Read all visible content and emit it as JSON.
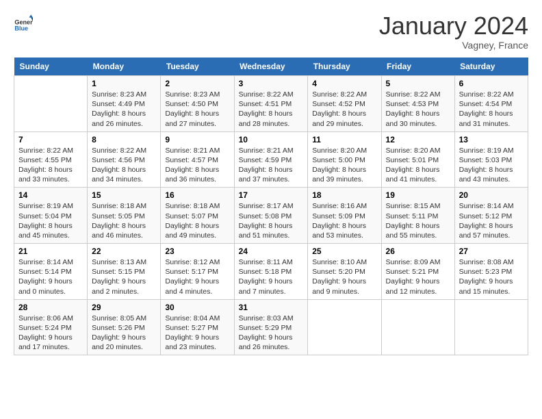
{
  "header": {
    "logo_general": "General",
    "logo_blue": "Blue",
    "month_title": "January 2024",
    "location": "Vagney, France"
  },
  "days_of_week": [
    "Sunday",
    "Monday",
    "Tuesday",
    "Wednesday",
    "Thursday",
    "Friday",
    "Saturday"
  ],
  "weeks": [
    [
      {
        "day": "",
        "sunrise": "",
        "sunset": "",
        "daylight": ""
      },
      {
        "day": "1",
        "sunrise": "8:23 AM",
        "sunset": "4:49 PM",
        "daylight": "8 hours and 26 minutes."
      },
      {
        "day": "2",
        "sunrise": "8:23 AM",
        "sunset": "4:50 PM",
        "daylight": "8 hours and 27 minutes."
      },
      {
        "day": "3",
        "sunrise": "8:22 AM",
        "sunset": "4:51 PM",
        "daylight": "8 hours and 28 minutes."
      },
      {
        "day": "4",
        "sunrise": "8:22 AM",
        "sunset": "4:52 PM",
        "daylight": "8 hours and 29 minutes."
      },
      {
        "day": "5",
        "sunrise": "8:22 AM",
        "sunset": "4:53 PM",
        "daylight": "8 hours and 30 minutes."
      },
      {
        "day": "6",
        "sunrise": "8:22 AM",
        "sunset": "4:54 PM",
        "daylight": "8 hours and 31 minutes."
      }
    ],
    [
      {
        "day": "7",
        "sunrise": "8:22 AM",
        "sunset": "4:55 PM",
        "daylight": "8 hours and 33 minutes."
      },
      {
        "day": "8",
        "sunrise": "8:22 AM",
        "sunset": "4:56 PM",
        "daylight": "8 hours and 34 minutes."
      },
      {
        "day": "9",
        "sunrise": "8:21 AM",
        "sunset": "4:57 PM",
        "daylight": "8 hours and 36 minutes."
      },
      {
        "day": "10",
        "sunrise": "8:21 AM",
        "sunset": "4:59 PM",
        "daylight": "8 hours and 37 minutes."
      },
      {
        "day": "11",
        "sunrise": "8:20 AM",
        "sunset": "5:00 PM",
        "daylight": "8 hours and 39 minutes."
      },
      {
        "day": "12",
        "sunrise": "8:20 AM",
        "sunset": "5:01 PM",
        "daylight": "8 hours and 41 minutes."
      },
      {
        "day": "13",
        "sunrise": "8:19 AM",
        "sunset": "5:03 PM",
        "daylight": "8 hours and 43 minutes."
      }
    ],
    [
      {
        "day": "14",
        "sunrise": "8:19 AM",
        "sunset": "5:04 PM",
        "daylight": "8 hours and 45 minutes."
      },
      {
        "day": "15",
        "sunrise": "8:18 AM",
        "sunset": "5:05 PM",
        "daylight": "8 hours and 46 minutes."
      },
      {
        "day": "16",
        "sunrise": "8:18 AM",
        "sunset": "5:07 PM",
        "daylight": "8 hours and 49 minutes."
      },
      {
        "day": "17",
        "sunrise": "8:17 AM",
        "sunset": "5:08 PM",
        "daylight": "8 hours and 51 minutes."
      },
      {
        "day": "18",
        "sunrise": "8:16 AM",
        "sunset": "5:09 PM",
        "daylight": "8 hours and 53 minutes."
      },
      {
        "day": "19",
        "sunrise": "8:15 AM",
        "sunset": "5:11 PM",
        "daylight": "8 hours and 55 minutes."
      },
      {
        "day": "20",
        "sunrise": "8:14 AM",
        "sunset": "5:12 PM",
        "daylight": "8 hours and 57 minutes."
      }
    ],
    [
      {
        "day": "21",
        "sunrise": "8:14 AM",
        "sunset": "5:14 PM",
        "daylight": "9 hours and 0 minutes."
      },
      {
        "day": "22",
        "sunrise": "8:13 AM",
        "sunset": "5:15 PM",
        "daylight": "9 hours and 2 minutes."
      },
      {
        "day": "23",
        "sunrise": "8:12 AM",
        "sunset": "5:17 PM",
        "daylight": "9 hours and 4 minutes."
      },
      {
        "day": "24",
        "sunrise": "8:11 AM",
        "sunset": "5:18 PM",
        "daylight": "9 hours and 7 minutes."
      },
      {
        "day": "25",
        "sunrise": "8:10 AM",
        "sunset": "5:20 PM",
        "daylight": "9 hours and 9 minutes."
      },
      {
        "day": "26",
        "sunrise": "8:09 AM",
        "sunset": "5:21 PM",
        "daylight": "9 hours and 12 minutes."
      },
      {
        "day": "27",
        "sunrise": "8:08 AM",
        "sunset": "5:23 PM",
        "daylight": "9 hours and 15 minutes."
      }
    ],
    [
      {
        "day": "28",
        "sunrise": "8:06 AM",
        "sunset": "5:24 PM",
        "daylight": "9 hours and 17 minutes."
      },
      {
        "day": "29",
        "sunrise": "8:05 AM",
        "sunset": "5:26 PM",
        "daylight": "9 hours and 20 minutes."
      },
      {
        "day": "30",
        "sunrise": "8:04 AM",
        "sunset": "5:27 PM",
        "daylight": "9 hours and 23 minutes."
      },
      {
        "day": "31",
        "sunrise": "8:03 AM",
        "sunset": "5:29 PM",
        "daylight": "9 hours and 26 minutes."
      },
      {
        "day": "",
        "sunrise": "",
        "sunset": "",
        "daylight": ""
      },
      {
        "day": "",
        "sunrise": "",
        "sunset": "",
        "daylight": ""
      },
      {
        "day": "",
        "sunrise": "",
        "sunset": "",
        "daylight": ""
      }
    ]
  ]
}
